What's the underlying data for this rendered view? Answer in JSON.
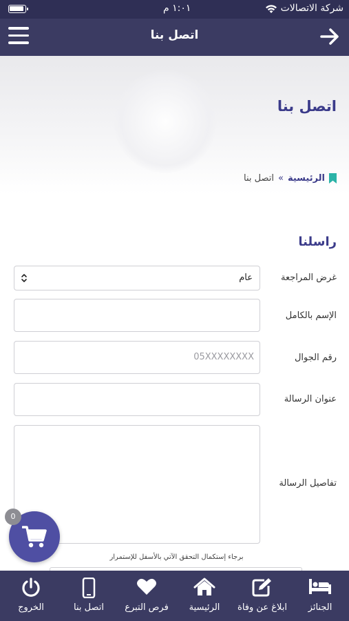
{
  "status_bar": {
    "carrier": "شركة الاتصالات",
    "time": "١:٠١ م"
  },
  "header": {
    "title": "اتصل بنا"
  },
  "page": {
    "title": "اتصل بنا"
  },
  "breadcrumb": {
    "home": "الرئيسية",
    "separator": "»",
    "current": "اتصل بنا"
  },
  "form": {
    "section_title": "راسلنا",
    "purpose_label": "غرض المراجعة",
    "purpose_value": "عام",
    "name_label": "الإسم بالكامل",
    "mobile_label": "رقم الجوال",
    "mobile_placeholder": "05XXXXXXXX",
    "subject_label": "عنوان الرسالة",
    "details_label": "تفاصيل الرسالة",
    "captcha_note": "برجاء إستكمال التحقق الآتي بالأسفل للإستمرار"
  },
  "cart": {
    "count": "0"
  },
  "bottom_nav": {
    "items": [
      {
        "label": "الجنائز",
        "icon": "bed-icon"
      },
      {
        "label": "ابلاغ عن وفاة",
        "icon": "edit-icon"
      },
      {
        "label": "الرئيسية",
        "icon": "home-icon"
      },
      {
        "label": "فرص التبرع",
        "icon": "heart-icon"
      },
      {
        "label": "اتصل بنا",
        "icon": "phone-icon"
      },
      {
        "label": "الخروج",
        "icon": "power-icon"
      }
    ]
  },
  "colors": {
    "header_bg": "#3b3b62",
    "accent": "#3b3b8a",
    "bookmark": "#2bb3a8",
    "cart_fab": "#4f4fa3"
  }
}
